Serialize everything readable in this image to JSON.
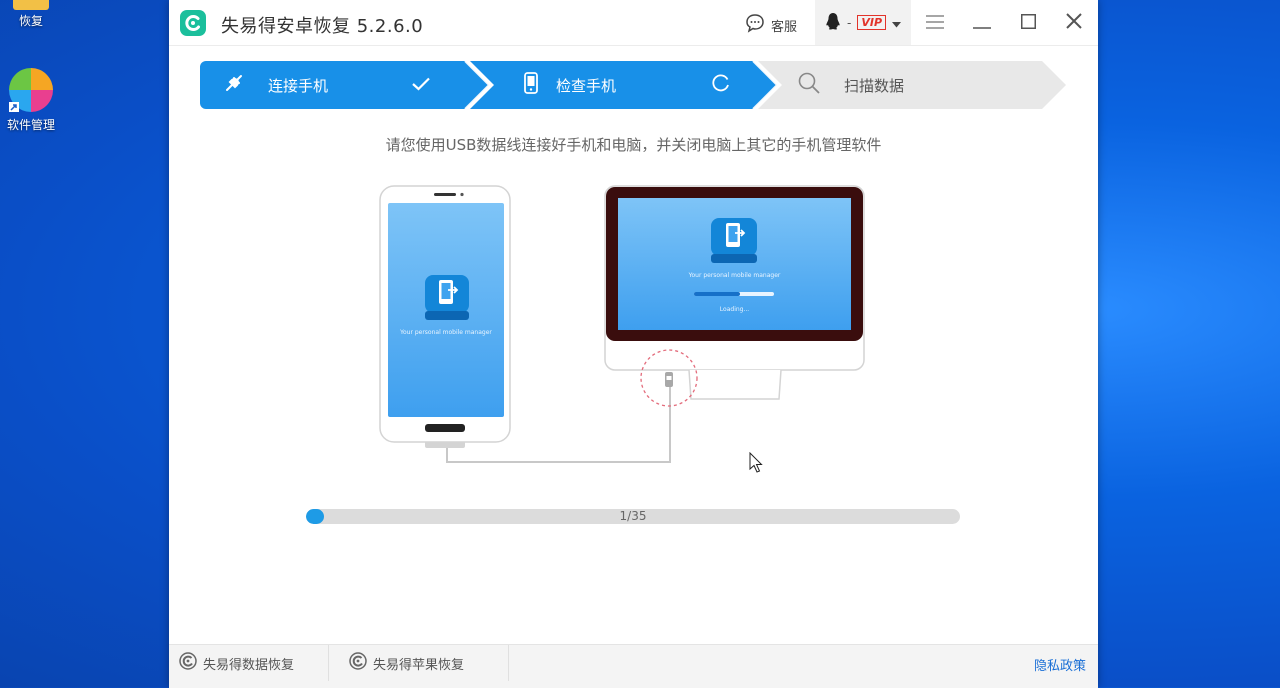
{
  "desktop": {
    "icons": [
      {
        "label": "恢复",
        "icon": "folder-icon"
      },
      {
        "label": "软件管理",
        "icon": "pinwheel-icon"
      }
    ]
  },
  "window": {
    "title": "失易得安卓恢复  5.2.6.0",
    "service_label": "客服",
    "account_dash": "-",
    "vip_label": "VIP"
  },
  "steps": [
    {
      "label": "连接手机",
      "status": "done"
    },
    {
      "label": "检查手机",
      "status": "in-progress"
    },
    {
      "label": "扫描数据",
      "status": "pending"
    }
  ],
  "hint": "请您使用USB数据线连接好手机和电脑，并关闭电脑上其它的手机管理软件",
  "illustration": {
    "phone_caption": "Your personal mobile manager",
    "monitor_caption": "Your personal mobile manager",
    "monitor_loading": "Loading..."
  },
  "progress": {
    "current": 1,
    "total": 35,
    "text": "1/35",
    "fraction": 0.028
  },
  "footer": {
    "tabs": [
      {
        "label": "失易得数据恢复"
      },
      {
        "label": "失易得苹果恢复"
      }
    ],
    "privacy": "隐私政策"
  },
  "colors": {
    "accent": "#1e9be6",
    "step_active": "#1890e8",
    "step_pending": "#e8e8e8",
    "desktop": "#0a5fdc"
  }
}
